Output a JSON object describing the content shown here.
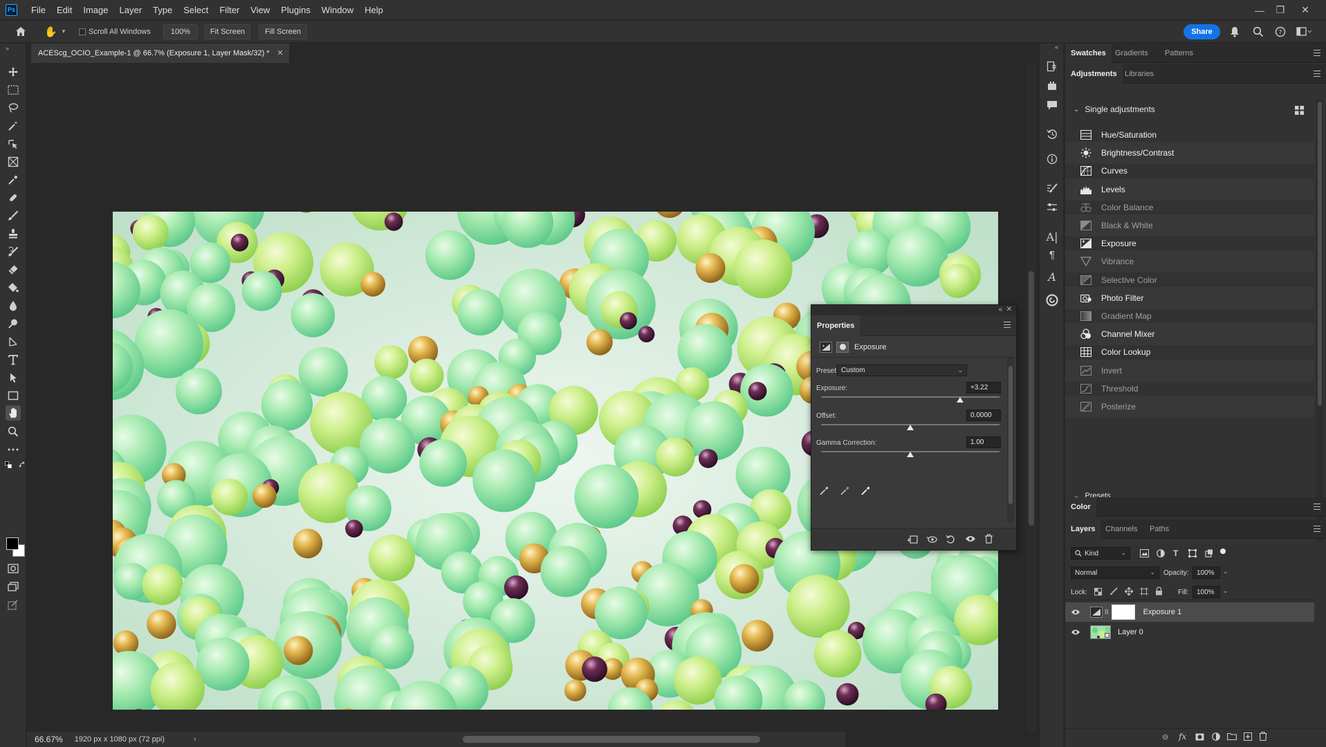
{
  "app": {
    "logo": "Ps",
    "window_controls": [
      "—",
      "❐",
      "✕"
    ]
  },
  "menu": [
    "File",
    "Edit",
    "Image",
    "Layer",
    "Type",
    "Select",
    "Filter",
    "View",
    "Plugins",
    "Window",
    "Help"
  ],
  "options_bar": {
    "scroll_all_windows": "Scroll All Windows",
    "scroll_all_checked": false,
    "zoom_value": "100%",
    "fit_screen": "Fit Screen",
    "fill_screen": "Fill Screen",
    "share": "Share"
  },
  "document": {
    "tab_title": "ACEScg_OCIO_Example-1 @ 66.7% (Exposure 1, Layer Mask/32) *",
    "zoom": "66.67%",
    "dimensions": "1920 px x 1080 px (72 ppi)"
  },
  "properties": {
    "title": "Properties",
    "adjustment_name": "Exposure",
    "preset_label": "Preset:",
    "preset_value": "Custom",
    "exposure_label": "Exposure:",
    "exposure_value": "+3.22",
    "exposure_fraction": 0.78,
    "offset_label": "Offset:",
    "offset_value": "0.0000",
    "offset_fraction": 0.5,
    "gamma_label": "Gamma Correction:",
    "gamma_value": "1.00",
    "gamma_fraction": 0.5
  },
  "panels": {
    "top_tabs": [
      "Swatches",
      "Gradients",
      "Patterns"
    ],
    "adjust_tabs": [
      "Adjustments",
      "Libraries"
    ],
    "single_adjustments": "Single adjustments",
    "presets": "Presets",
    "adjustments": [
      {
        "label": "Hue/Saturation",
        "icon": "hue-saturation-icon",
        "enabled": true
      },
      {
        "label": "Brightness/Contrast",
        "icon": "brightness-icon",
        "enabled": true
      },
      {
        "label": "Curves",
        "icon": "curves-icon",
        "enabled": true
      },
      {
        "label": "Levels",
        "icon": "levels-icon",
        "enabled": true
      },
      {
        "label": "Color Balance",
        "icon": "color-balance-icon",
        "enabled": false
      },
      {
        "label": "Black & White",
        "icon": "black-white-icon",
        "enabled": false
      },
      {
        "label": "Exposure",
        "icon": "exposure-icon",
        "enabled": true
      },
      {
        "label": "Vibrance",
        "icon": "vibrance-icon",
        "enabled": false
      },
      {
        "label": "Selective Color",
        "icon": "selective-color-icon",
        "enabled": false
      },
      {
        "label": "Photo Filter",
        "icon": "photo-filter-icon",
        "enabled": true
      },
      {
        "label": "Gradient Map",
        "icon": "gradient-map-icon",
        "enabled": false
      },
      {
        "label": "Channel Mixer",
        "icon": "channel-mixer-icon",
        "enabled": true
      },
      {
        "label": "Color Lookup",
        "icon": "color-lookup-icon",
        "enabled": true
      },
      {
        "label": "Invert",
        "icon": "invert-icon",
        "enabled": false
      },
      {
        "label": "Threshold",
        "icon": "threshold-icon",
        "enabled": false
      },
      {
        "label": "Posterize",
        "icon": "posterize-icon",
        "enabled": false
      }
    ],
    "color_tab": "Color",
    "layers_tabs": [
      "Layers",
      "Channels",
      "Paths"
    ],
    "kind_label": "Kind",
    "blend_mode": "Normal",
    "opacity_label": "Opacity:",
    "opacity_value": "100%",
    "lock_label": "Lock:",
    "fill_label": "Fill:",
    "fill_value": "100%",
    "layers": [
      {
        "name": "Exposure 1",
        "selected": true
      },
      {
        "name": "Layer 0",
        "selected": false
      }
    ]
  },
  "colors": {
    "accent": "#1473e6",
    "panel_bg": "#323232",
    "canvas_bg": "#282828"
  }
}
